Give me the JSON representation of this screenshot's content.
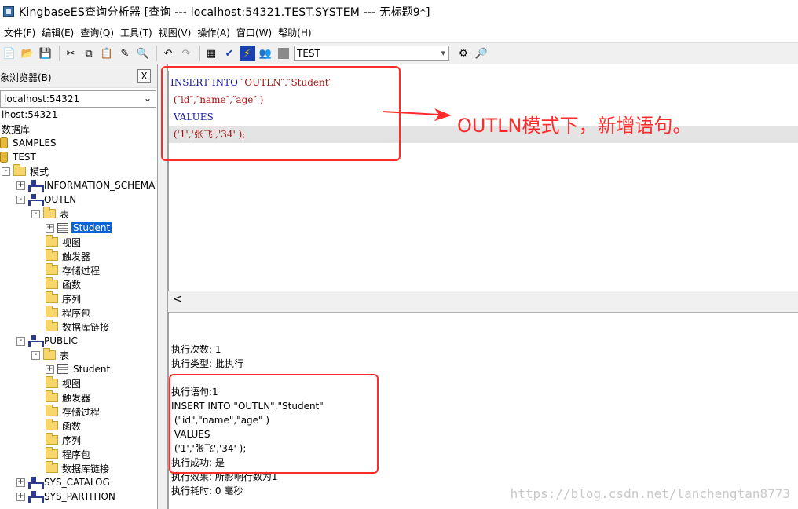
{
  "window": {
    "title": "KingbaseES查询分析器 [查询  ---  localhost:54321.TEST.SYSTEM  ---  无标题9*]"
  },
  "menu": [
    {
      "label": "文件(F)"
    },
    {
      "label": "编辑(E)"
    },
    {
      "label": "查询(Q)"
    },
    {
      "label": "工具(T)"
    },
    {
      "label": "视图(V)"
    },
    {
      "label": "操作(A)"
    },
    {
      "label": "窗口(W)"
    },
    {
      "label": "帮助(H)"
    }
  ],
  "toolbar": {
    "icons": [
      "new-file-icon",
      "open-folder-icon",
      "save-icon",
      "cut-icon",
      "copy-icon",
      "paste-icon",
      "edit-icon",
      "find-icon",
      "undo-icon",
      "redo-icon",
      "grid-icon",
      "check-icon",
      "execute-icon",
      "users-icon",
      "stop-icon"
    ],
    "database_select": "TEST"
  },
  "object_browser": {
    "title": "对象浏览器(B)",
    "close_label": "X",
    "server_select": "localhost:54321",
    "tree": [
      {
        "label": "lhost:54321",
        "icon": "none",
        "indent": 0,
        "expander": ""
      },
      {
        "label": "数据库",
        "icon": "none",
        "indent": 0,
        "expander": ""
      },
      {
        "label": "SAMPLES",
        "icon": "db",
        "indent": 0,
        "expander": ""
      },
      {
        "label": "TEST",
        "icon": "db",
        "indent": 0,
        "expander": ""
      },
      {
        "label": "模式",
        "icon": "folder",
        "indent": 1,
        "expander": "-"
      },
      {
        "label": "INFORMATION_SCHEMA",
        "icon": "schema",
        "indent": 2,
        "expander": "+"
      },
      {
        "label": "OUTLN",
        "icon": "schema",
        "indent": 2,
        "expander": "-"
      },
      {
        "label": "表",
        "icon": "folder",
        "indent": 3,
        "expander": "-"
      },
      {
        "label": "Student",
        "icon": "table",
        "indent": 4,
        "expander": "+",
        "selected": true
      },
      {
        "label": "视图",
        "icon": "folder",
        "indent": 4,
        "expander": ""
      },
      {
        "label": "触发器",
        "icon": "folder",
        "indent": 4,
        "expander": ""
      },
      {
        "label": "存储过程",
        "icon": "folder",
        "indent": 4,
        "expander": ""
      },
      {
        "label": "函数",
        "icon": "folder",
        "indent": 4,
        "expander": ""
      },
      {
        "label": "序列",
        "icon": "folder",
        "indent": 4,
        "expander": ""
      },
      {
        "label": "程序包",
        "icon": "folder",
        "indent": 4,
        "expander": ""
      },
      {
        "label": "数据库链接",
        "icon": "folder",
        "indent": 4,
        "expander": ""
      },
      {
        "label": "PUBLIC",
        "icon": "schema",
        "indent": 2,
        "expander": "-"
      },
      {
        "label": "表",
        "icon": "folder",
        "indent": 3,
        "expander": "-"
      },
      {
        "label": "Student",
        "icon": "table",
        "indent": 4,
        "expander": "+"
      },
      {
        "label": "视图",
        "icon": "folder",
        "indent": 4,
        "expander": ""
      },
      {
        "label": "触发器",
        "icon": "folder",
        "indent": 4,
        "expander": ""
      },
      {
        "label": "存储过程",
        "icon": "folder",
        "indent": 4,
        "expander": ""
      },
      {
        "label": "函数",
        "icon": "folder",
        "indent": 4,
        "expander": ""
      },
      {
        "label": "序列",
        "icon": "folder",
        "indent": 4,
        "expander": ""
      },
      {
        "label": "程序包",
        "icon": "folder",
        "indent": 4,
        "expander": ""
      },
      {
        "label": "数据库链接",
        "icon": "folder",
        "indent": 4,
        "expander": ""
      },
      {
        "label": "SYS_CATALOG",
        "icon": "schema",
        "indent": 2,
        "expander": "+"
      },
      {
        "label": "SYS_PARTITION",
        "icon": "schema",
        "indent": 2,
        "expander": "+"
      }
    ]
  },
  "editor": {
    "line1_kw": "INSERT INTO ",
    "line1_str": "″OUTLN″.″Student″",
    "line2": " (″id″,″name″,″age″ )",
    "line3": " VALUES",
    "line4": " ('1','张飞','34' );",
    "scroll_left": "<"
  },
  "results": {
    "lines": [
      "执行次数: 1",
      "执行类型: 批执行",
      "",
      "执行语句:1",
      "INSERT INTO \"OUTLN\".\"Student\"",
      " (\"id\",\"name\",\"age\" )",
      " VALUES",
      " ('1','张飞','34' );",
      "执行成功: 是",
      "执行效果: 所影响行数为1",
      "执行耗时: 0 毫秒"
    ]
  },
  "annotation": {
    "text": "OUTLN模式下，新增语句。",
    "color": "#ff2a2a"
  },
  "watermark": "https://blog.csdn.net/lanchengtan8773"
}
